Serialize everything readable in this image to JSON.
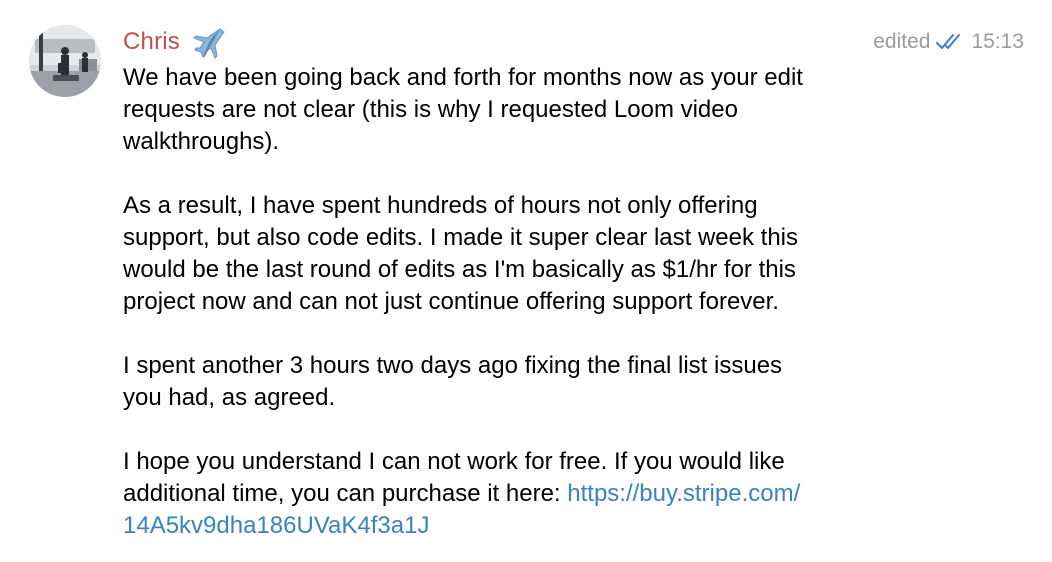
{
  "message": {
    "sender": {
      "name": "Chris",
      "emoji": "airplane-icon",
      "name_color": "#c0504d"
    },
    "status": {
      "edited_label": "edited",
      "read_icon": "double-check-icon",
      "time": "15:13",
      "check_color": "#3b82c4"
    },
    "paragraphs": [
      "We have been going back and forth for months now as your edit\nrequests are not clear (this is why I requested Loom video\nwalkthroughs).",
      "As a result, I have spent hundreds of hours not only offering\nsupport, but also code edits. I made it super clear last week this\nwould be the last round of edits as I'm basically as $1/hr for this\nproject now and can not just continue offering support forever.",
      "I spent another 3 hours two days ago fixing the final list issues\nyou had, as agreed."
    ],
    "last_paragraph": {
      "text": "I hope you understand I can not work for free. If you would like\nadditional time, you can purchase it here: ",
      "link_text": "https://buy.stripe.com/\n14A5kv9dha186UVaK4f3a1J",
      "link_color": "#3b82c4"
    }
  }
}
